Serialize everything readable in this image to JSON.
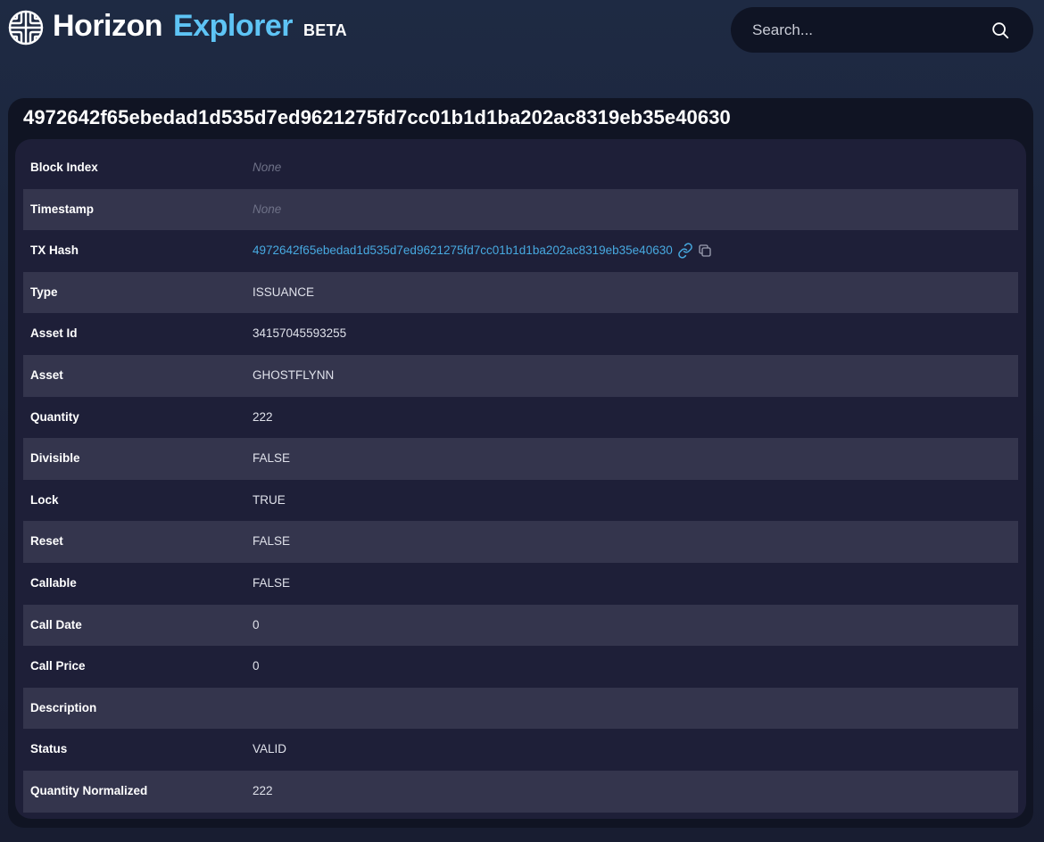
{
  "header": {
    "brand_horizon": "Horizon",
    "brand_explorer": "Explorer",
    "beta_label": "BETA",
    "logo_icon": "horizon-logo-icon",
    "accent_color": "#5ec4f5"
  },
  "search": {
    "placeholder": "Search...",
    "value": "",
    "icon": "search-icon"
  },
  "transaction": {
    "title": "4972642f65ebedad1d535d7ed9621275fd7cc01b1d1ba202ac8319eb35e40630",
    "rows": [
      {
        "label": "Block Index",
        "value": "None"
      },
      {
        "label": "Timestamp",
        "value": "None"
      },
      {
        "label": "TX Hash",
        "value": "4972642f65ebedad1d535d7ed9621275fd7cc01b1d1ba202ac8319eb35e40630"
      },
      {
        "label": "Type",
        "value": "ISSUANCE"
      },
      {
        "label": "Asset Id",
        "value": "34157045593255"
      },
      {
        "label": "Asset",
        "value": "GHOSTFLYNN"
      },
      {
        "label": "Quantity",
        "value": "222"
      },
      {
        "label": "Divisible",
        "value": "FALSE"
      },
      {
        "label": "Lock",
        "value": "TRUE"
      },
      {
        "label": "Reset",
        "value": "FALSE"
      },
      {
        "label": "Callable",
        "value": "FALSE"
      },
      {
        "label": "Call Date",
        "value": "0"
      },
      {
        "label": "Call Price",
        "value": "0"
      },
      {
        "label": "Description",
        "value": ""
      },
      {
        "label": "Status",
        "value": "VALID"
      },
      {
        "label": "Quantity Normalized",
        "value": "222"
      }
    ],
    "tx_hash_icons": [
      "link-icon",
      "copy-icon"
    ],
    "link_color": "#47a9e0"
  }
}
